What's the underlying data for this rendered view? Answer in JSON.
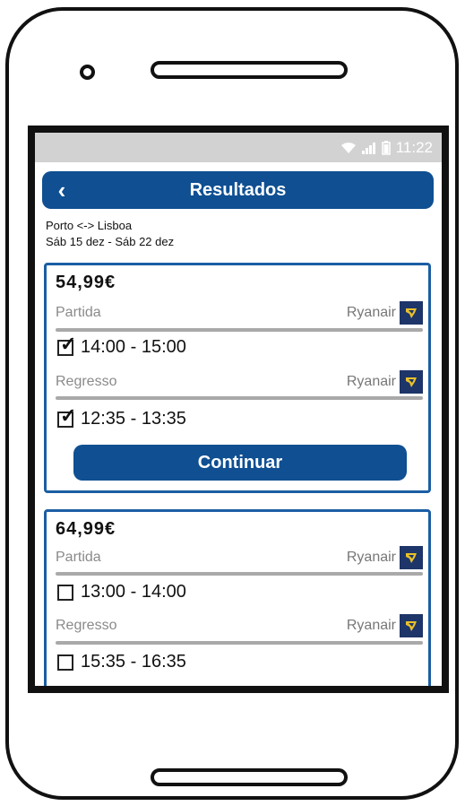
{
  "status_bar": {
    "time": "11:22"
  },
  "header": {
    "back_icon": "chevron-left-icon",
    "title": "Resultados"
  },
  "route": {
    "cities": "Porto <-> Lisboa",
    "dates": "Sáb 15 dez - Sáb 22 dez"
  },
  "results": [
    {
      "price": "54,99€",
      "outbound": {
        "label": "Partida",
        "airline": "Ryanair",
        "time": "14:00 - 15:00",
        "checked": true
      },
      "return": {
        "label": "Regresso",
        "airline": "Ryanair",
        "time": "12:35 - 13:35",
        "checked": true
      },
      "continue_label": "Continuar"
    },
    {
      "price": "64,99€",
      "outbound": {
        "label": "Partida",
        "airline": "Ryanair",
        "time": "13:00 - 14:00",
        "checked": false
      },
      "return": {
        "label": "Regresso",
        "airline": "Ryanair",
        "time": "15:35 - 16:35",
        "checked": false
      }
    }
  ],
  "colors": {
    "accent": "#0f4f92",
    "card_border": "#1b5ea4",
    "logo_bg": "#1d3568",
    "logo_mark": "#e8c02a"
  }
}
